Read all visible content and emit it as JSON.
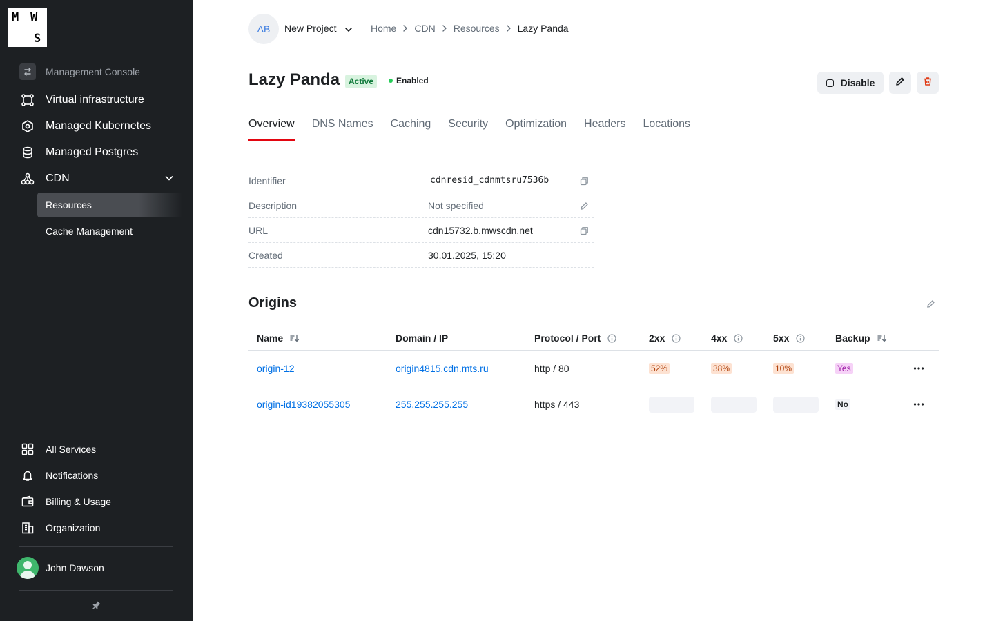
{
  "logo": {
    "l1": "M",
    "l2": "W",
    "l3": "S"
  },
  "sidebar": {
    "console_label": "Management Console",
    "nav": [
      {
        "label": "Virtual infrastructure",
        "icon": "vm-icon"
      },
      {
        "label": "Managed Kubernetes",
        "icon": "kubernetes-icon"
      },
      {
        "label": "Managed Postgres",
        "icon": "database-icon"
      },
      {
        "label": "CDN",
        "icon": "cdn-icon"
      }
    ],
    "sub": [
      {
        "label": "Resources",
        "active": true
      },
      {
        "label": "Cache Management",
        "active": false
      }
    ],
    "bottom": [
      {
        "label": "All Services",
        "icon": "grid-icon"
      },
      {
        "label": "Notifications",
        "icon": "bell-icon"
      },
      {
        "label": "Billing & Usage",
        "icon": "wallet-icon"
      },
      {
        "label": "Organization",
        "icon": "building-icon"
      }
    ],
    "user_name": "John Dawson"
  },
  "header": {
    "project_initials": "AB",
    "project_name": "New Project",
    "breadcrumbs": [
      "Home",
      "CDN",
      "Resources",
      "Lazy Panda"
    ]
  },
  "resource": {
    "title": "Lazy Panda",
    "status_badge": "Active",
    "state": "Enabled",
    "disable_label": "Disable"
  },
  "tabs": [
    "Overview",
    "DNS Names",
    "Caching",
    "Security",
    "Optimization",
    "Headers",
    "Locations"
  ],
  "info": {
    "identifier_label": "Identifier",
    "identifier_value": "cdnresid_cdnmtsru7536b",
    "description_label": "Description",
    "description_value": "Not specified",
    "url_label": "URL",
    "url_value": "cdn15732.b.mwscdn.net",
    "created_label": "Created",
    "created_value": "30.01.2025, 15:20"
  },
  "origins": {
    "title": "Origins",
    "columns": [
      "Name",
      "Domain / IP",
      "Protocol / Port",
      "2xx",
      "4xx",
      "5xx",
      "Backup"
    ],
    "rows": [
      {
        "name": "origin-12",
        "domain": "origin4815.cdn.mts.ru",
        "protocol": "http / 80",
        "r2xx": "52%",
        "r4xx": "38%",
        "r5xx": "10%",
        "backup": "Yes"
      },
      {
        "name": "origin-id19382055305",
        "domain": "255.255.255.255",
        "protocol": "https / 443",
        "r2xx": "",
        "r4xx": "",
        "r5xx": "",
        "backup": "No"
      }
    ]
  },
  "colors": {
    "sidebar_bg": "#1d2023",
    "accent_red": "#e30611",
    "link_blue": "#0070e5",
    "active_badge_bg": "#d8f3df",
    "enabled_dot": "#26cd58"
  }
}
